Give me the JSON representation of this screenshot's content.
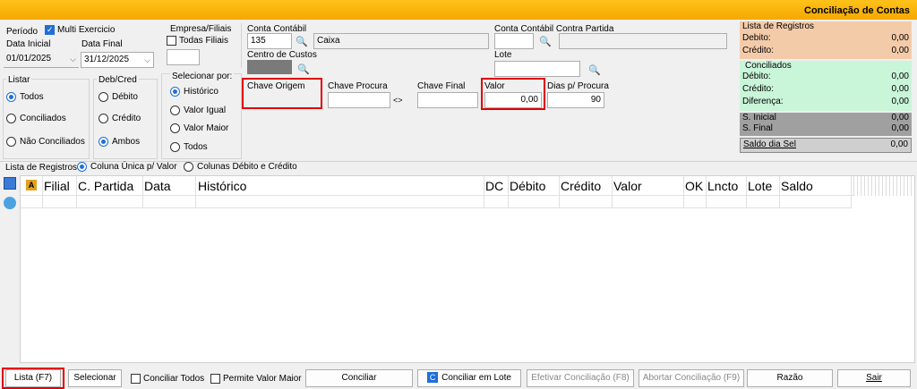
{
  "title": "Conciliação de Contas",
  "periodo": {
    "label": "Período",
    "multi_exercicio": "Multi Exercicio",
    "data_inicial_label": "Data Inicial",
    "data_final_label": "Data Final",
    "data_inicial": "01/01/2025",
    "data_final": "31/12/2025"
  },
  "empresa": {
    "label": "Empresa/Filiais",
    "todas_filiais": "Todas Filiais"
  },
  "conta": {
    "conta_contabil_label": "Conta Contábil",
    "conta_contabil_value": "135",
    "conta_contabil_desc": "Caixa",
    "centro_custos_label": "Centro de Custos",
    "contra_partida_label": "Conta Contábil Contra Partida",
    "lote_label": "Lote"
  },
  "listar": {
    "label": "Listar",
    "options": [
      "Todos",
      "Conciliados",
      "Não Conciliados"
    ]
  },
  "debcred": {
    "label": "Deb/Cred",
    "options": [
      "Débito",
      "Crédito",
      "Ambos"
    ]
  },
  "selecionar_por": {
    "label": "Selecionar por:",
    "options": [
      "Histórico",
      "Valor Igual",
      "Valor Maior",
      "Todos"
    ]
  },
  "filtros": {
    "chave_origem": "Chave Origem",
    "chave_procura": "Chave Procura",
    "swap": "<>",
    "chave_final": "Chave Final",
    "valor_label": "Valor",
    "valor_value": "0,00",
    "dias_label": "Dias p/ Procura",
    "dias_value": "90"
  },
  "lista_registros": {
    "title": "Lista de Registros",
    "debito_label": "Debito:",
    "debito_value": "0,00",
    "credito_label": "Crédito:",
    "credito_value": "0,00"
  },
  "conciliados": {
    "title": "Conciliados",
    "debito_label": "Débito:",
    "debito_value": "0,00",
    "credito_label": "Crédito:",
    "credito_value": "0,00",
    "diferenca_label": "Diferença:",
    "diferenca_value": "0,00"
  },
  "saldos": {
    "inicial_label": "S. Inicial",
    "inicial_value": "0,00",
    "final_label": "S. Final",
    "final_value": "0,00",
    "dia_sel_label": "Saldo dia Sel",
    "dia_sel_value": "0,00"
  },
  "grid_mode": {
    "label": "Lista de Registros",
    "option1": "Coluna Única p/ Valor",
    "option2": "Colunas Débito e Crédito"
  },
  "grid": {
    "columns": [
      "Filial",
      "C. Partida",
      "Data",
      "Histórico",
      "DC",
      "Débito",
      "Crédito",
      "Valor",
      "OK",
      "Lncto",
      "Lote",
      "Saldo"
    ]
  },
  "bottom": {
    "lista": "Lista (F7)",
    "selecionar": "Selecionar",
    "conciliar_todos": "Conciliar Todos",
    "permite_valor_maior": "Permite Valor Maior",
    "conciliar": "Conciliar",
    "conciliar_lote": "Conciliar  em Lote",
    "efetivar": "Efetivar Conciliação (F8)",
    "abortar": "Abortar Conciliação (F9)",
    "razao": "Razão",
    "sair": "Sair"
  },
  "colors": {
    "title_bar": "#f5a800",
    "lista_panel": "#f4cba9",
    "conciliados_panel": "#c9f5d9",
    "saldo_panel": "#a0a0a0",
    "highlight": "#e00000",
    "radio_selected": "#1e6fd9"
  }
}
